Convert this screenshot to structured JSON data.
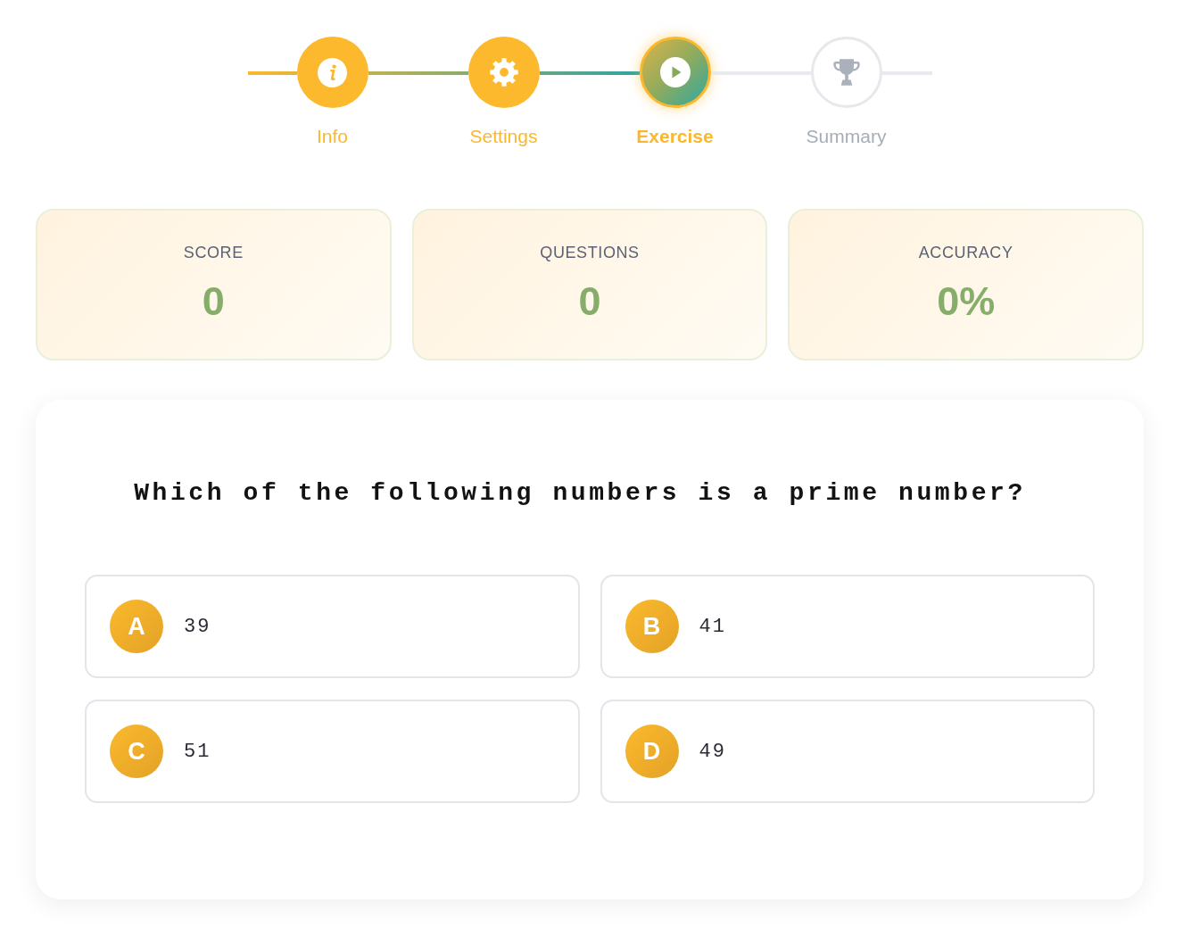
{
  "stepper": {
    "steps": [
      {
        "label": "Info",
        "completed": true,
        "selected": false
      },
      {
        "label": "Settings",
        "completed": true,
        "selected": false
      },
      {
        "label": "Exercise",
        "completed": false,
        "selected": true
      },
      {
        "label": "Summary",
        "completed": false,
        "selected": false
      }
    ]
  },
  "stats": [
    {
      "label": "SCORE",
      "value": "0"
    },
    {
      "label": "QUESTIONS",
      "value": "0"
    },
    {
      "label": "ACCURACY",
      "value": "0%"
    }
  ],
  "question": {
    "text": "Which of the following numbers is a prime number?",
    "options": [
      {
        "letter": "A",
        "text": "39",
        "selected": false
      },
      {
        "letter": "B",
        "text": "41",
        "selected": false
      },
      {
        "letter": "C",
        "text": "51",
        "selected": false
      },
      {
        "letter": "D",
        "text": "49",
        "selected": false
      }
    ]
  }
}
